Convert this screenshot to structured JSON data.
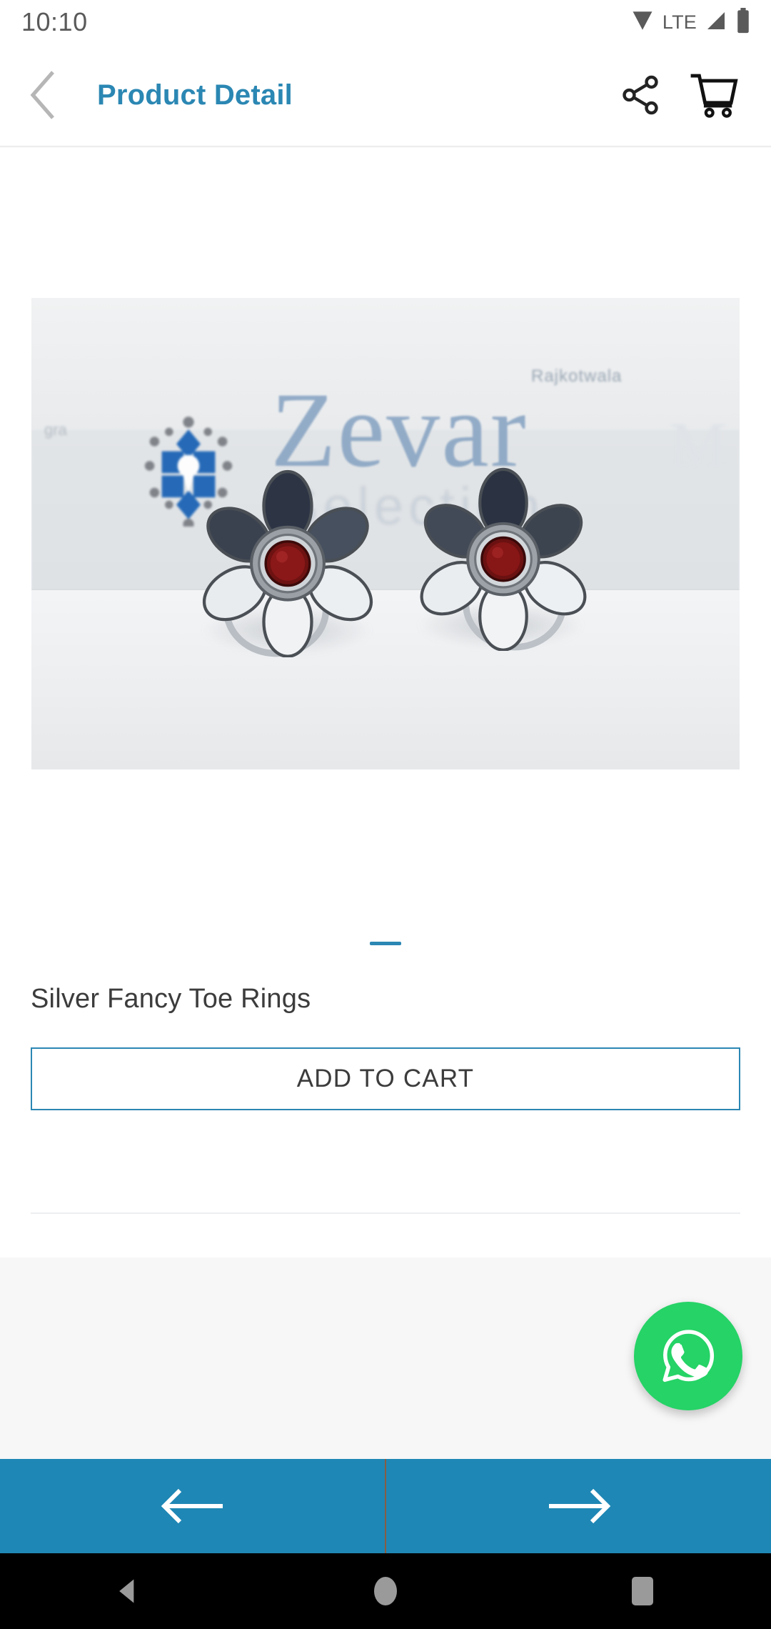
{
  "status_bar": {
    "clock": "10:10",
    "network_label": "LTE",
    "icons": [
      "wifi-icon",
      "signal-icon",
      "battery-icon"
    ]
  },
  "app_bar": {
    "back_icon": "chevron-left-icon",
    "title": "Product Detail",
    "share_icon": "share-icon",
    "cart_icon": "shopping-cart-icon",
    "title_color": "#2b87b3"
  },
  "product": {
    "name": "Silver Fancy Toe Rings",
    "image_alt": "Silver flower shaped toe rings pair with red center stone",
    "brand_on_image": "Zevar",
    "brand_tagline_on_image": "Selection",
    "brand_tm_on_image": "Rajkotwala"
  },
  "pager": {
    "current_page": 1,
    "total_pages": 1,
    "indicator_color": "#2b87b3"
  },
  "actions": {
    "add_to_cart_label": "ADD TO CART",
    "add_to_cart_border_color": "#2b87b3"
  },
  "floating_action": {
    "icon": "whatsapp-icon",
    "background_color": "#25d366"
  },
  "bottom_nav": {
    "background_color": "#1f87b5",
    "divider_color": "#8a5b42",
    "prev_icon": "arrow-left-icon",
    "next_icon": "arrow-right-icon"
  },
  "android_nav": {
    "back_icon": "triangle-back-icon",
    "home_icon": "circle-home-icon",
    "recents_icon": "square-recents-icon"
  }
}
